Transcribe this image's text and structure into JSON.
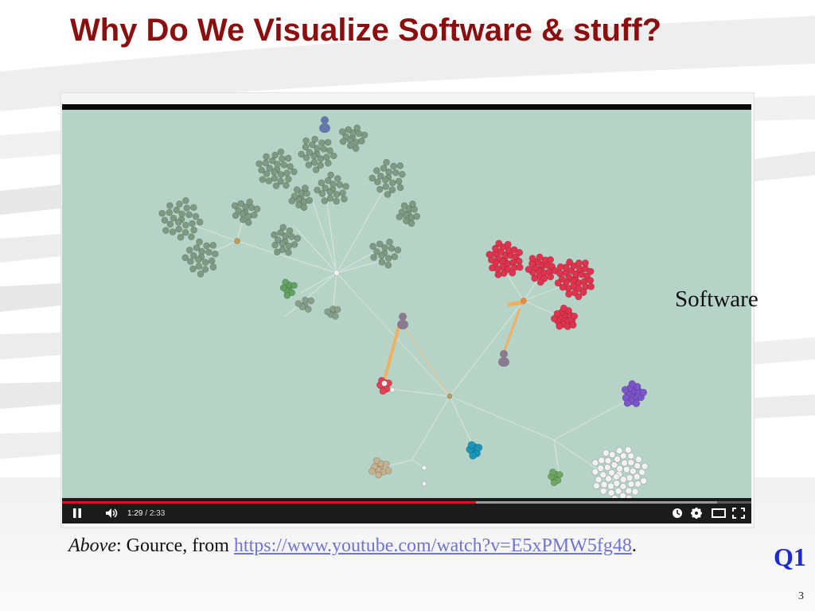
{
  "slide": {
    "title": "Why Do We Visualize Software & stuff?",
    "side_label": "Software",
    "caption": {
      "above": "Above",
      "text": ": Gource, from ",
      "link": "https://www.youtube.com/watch?v=E5xPMW5fg48",
      "end": "."
    },
    "question_tag": "Q1",
    "page_number": "3"
  },
  "player": {
    "current_time": "1:29",
    "separator": " / ",
    "duration": "2:33",
    "progress": 0.6,
    "buffered": 0.95,
    "icons": [
      "pause-icon",
      "volume-icon",
      "watch-later-icon",
      "gear-icon",
      "theater-mode-icon",
      "fullscreen-icon"
    ],
    "colors": {
      "video_bg": "#b5d3c6",
      "progress": "#cc181e",
      "controls_bg": "#1b1b1b"
    }
  },
  "colors": {
    "title": "#8b0f0f",
    "link": "#6f72d6",
    "q1": "#1a2bd6"
  }
}
